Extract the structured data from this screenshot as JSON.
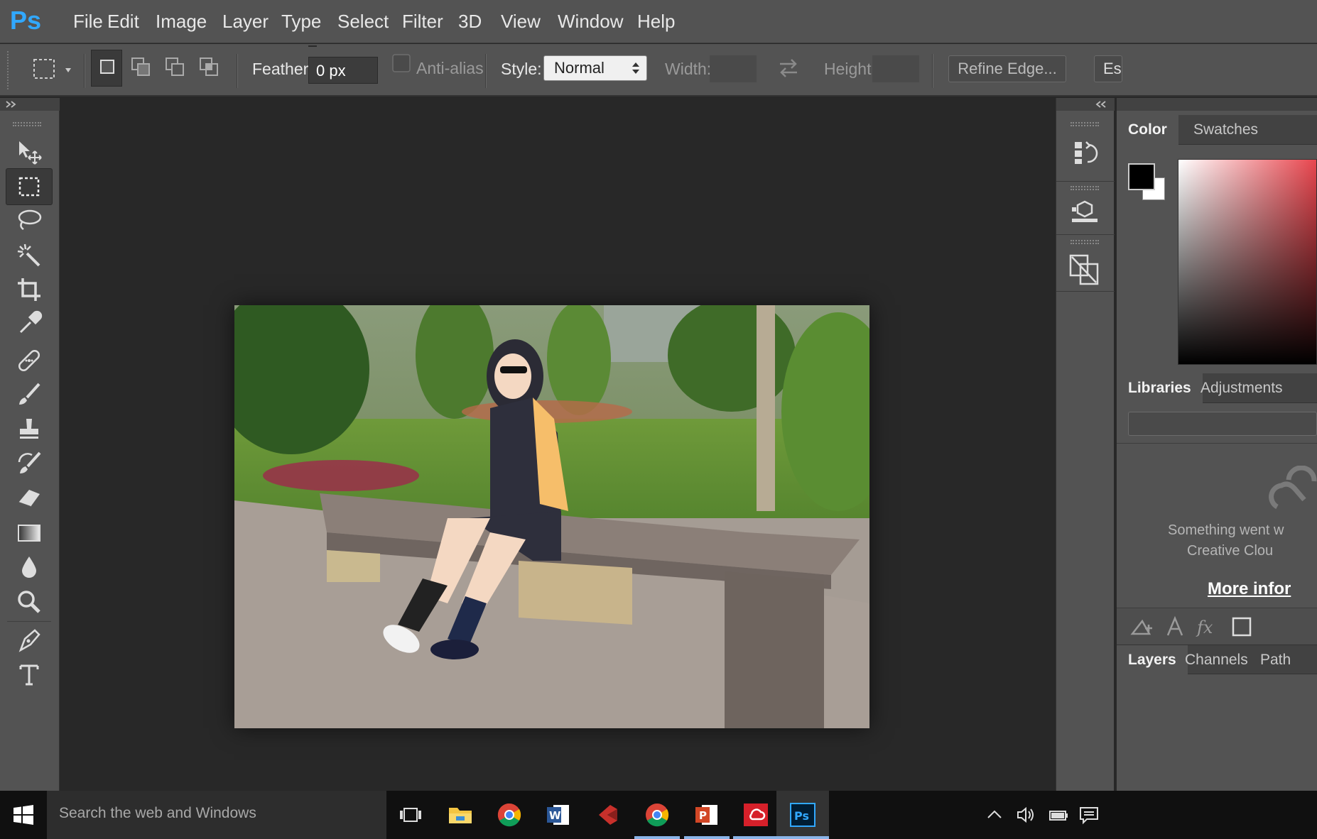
{
  "app": {
    "logo": "Ps"
  },
  "menu": [
    "File",
    "Edit",
    "Image",
    "Layer",
    "Type",
    "Select",
    "Filter",
    "3D",
    "View",
    "Window",
    "Help"
  ],
  "options": {
    "feather_label": "Feather:",
    "feather_value": "0 px",
    "antialias_label": "Anti-alias",
    "style_label": "Style:",
    "style_value": "Normal",
    "width_label": "Width:",
    "height_label": "Height:",
    "refine_edge": "Refine Edge...",
    "extra_button": "Es"
  },
  "tools": [
    "move-tool",
    "rectangular-marquee-tool",
    "lasso-tool",
    "magic-wand-tool",
    "crop-tool",
    "eyedropper-tool",
    "healing-brush-tool",
    "brush-tool",
    "clone-stamp-tool",
    "history-brush-tool",
    "eraser-tool",
    "gradient-tool",
    "blur-tool",
    "zoom-tool",
    "pen-tool",
    "type-tool"
  ],
  "panels": {
    "color_tab": "Color",
    "swatches_tab": "Swatches",
    "libraries_tab": "Libraries",
    "adjustments_tab": "Adjustments",
    "libraries_error_line1": "Something went w",
    "libraries_error_line2": "Creative Clou",
    "libraries_more_info": "More infor",
    "layers_tab": "Layers",
    "channels_tab": "Channels",
    "paths_tab": "Path"
  },
  "colors": {
    "foreground": "#000000",
    "background": "#ffffff",
    "accent": "#31a8ff"
  },
  "taskbar": {
    "search_placeholder": "Search the web and Windows",
    "apps": [
      "task-view",
      "file-explorer",
      "chrome",
      "word",
      "app-red",
      "chrome",
      "powerpoint",
      "creative-cloud",
      "photoshop"
    ]
  }
}
